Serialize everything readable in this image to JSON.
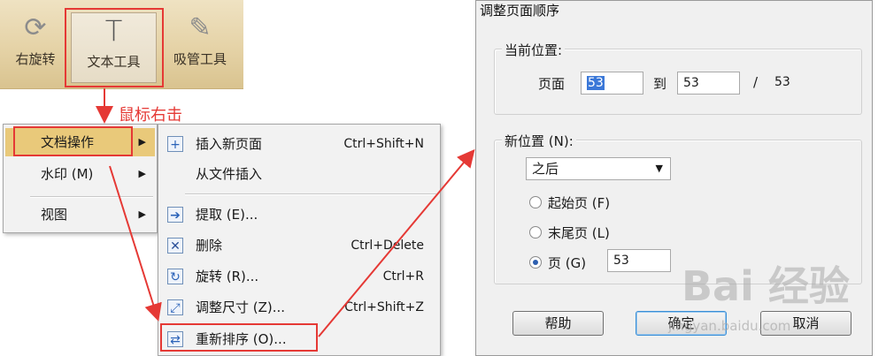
{
  "toolbar": {
    "rotate_label": "右旋转",
    "text_tool_label": "文本工具",
    "text_tool_icon": "T",
    "picker_label": "吸管工具"
  },
  "annotation": {
    "right_click": "鼠标右击"
  },
  "context_menu": {
    "items": [
      {
        "label": "文档操作",
        "has_submenu": true,
        "highlighted": true
      },
      {
        "label": "水印 (M)",
        "has_submenu": true
      },
      {
        "label": "视图",
        "has_submenu": true
      }
    ]
  },
  "submenu": {
    "items": [
      {
        "label": "插入新页面",
        "shortcut": "Ctrl+Shift+N",
        "icon": "insert-page-icon"
      },
      {
        "label": "从文件插入",
        "shortcut": "",
        "icon": ""
      },
      {
        "label": "提取 (E)...",
        "shortcut": "",
        "icon": "extract-icon"
      },
      {
        "label": "删除",
        "shortcut": "Ctrl+Delete",
        "icon": "delete-icon"
      },
      {
        "label": "旋转 (R)...",
        "shortcut": "Ctrl+R",
        "icon": "rotate-icon"
      },
      {
        "label": "调整尺寸 (Z)...",
        "shortcut": "Ctrl+Shift+Z",
        "icon": "resize-icon"
      },
      {
        "label": "重新排序 (O)...",
        "shortcut": "",
        "icon": "reorder-icon"
      }
    ]
  },
  "dialog": {
    "title": "调整页面顺序",
    "current_position": {
      "legend": "当前位置:",
      "page_label": "页面",
      "from_value": "53",
      "to_label": "到",
      "to_value": "53",
      "slash": "/",
      "total": "53"
    },
    "new_position": {
      "legend": "新位置 (N):",
      "select_value": "之后",
      "radio_first": "起始页 (F)",
      "radio_last": "末尾页 (L)",
      "radio_page": "页 (G)",
      "page_value": "53",
      "selected": "page"
    },
    "buttons": {
      "help": "帮助",
      "ok": "确定",
      "cancel": "取消"
    }
  },
  "watermark": {
    "brand": "Bai 经验",
    "url": "jingyan.baidu.com"
  },
  "colors": {
    "accent_red": "#e53935",
    "menu_highlight": "#e9c97a",
    "toolbar_bg": "#e4d1a4"
  }
}
